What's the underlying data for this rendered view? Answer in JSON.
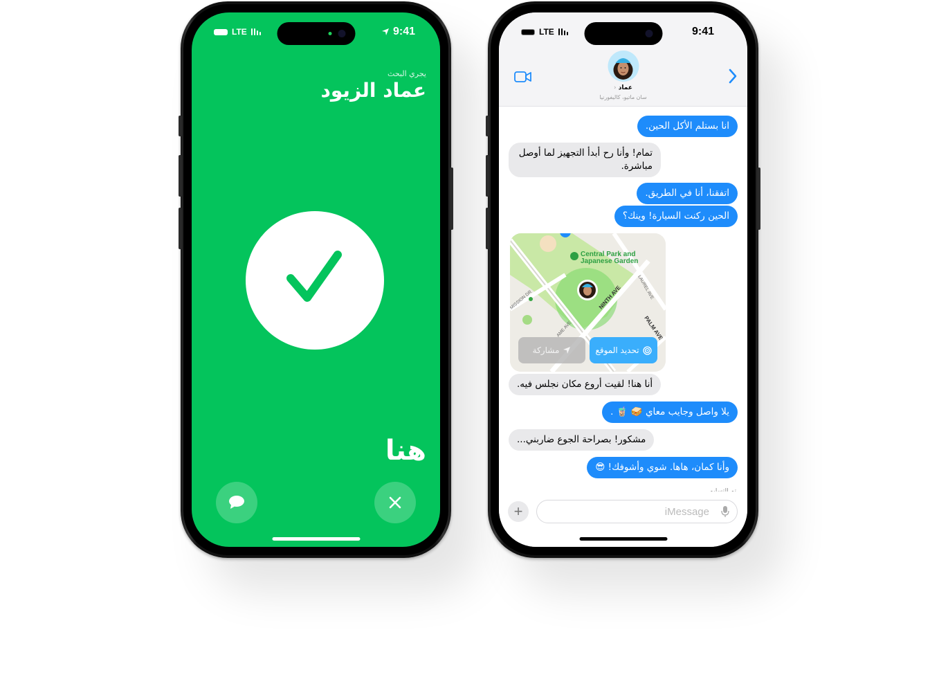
{
  "left_phone": {
    "status": {
      "network": "LTE",
      "time": "9:41"
    },
    "subtitle": "يجري البحث",
    "name": "عماد الزيود",
    "here_label": "هنا",
    "colors": {
      "background": "#04c45c"
    },
    "icons": {
      "check": "checkmark-icon",
      "message": "message-bubble-icon",
      "close": "close-x-icon"
    }
  },
  "right_phone": {
    "status": {
      "network": "LTE",
      "time": "9:41"
    },
    "header": {
      "contact_name": "عماد",
      "contact_location": "سان ماتيو، كاليفورنيا",
      "icons": {
        "video": "video-camera-icon",
        "forward": "chevron-right-icon"
      }
    },
    "messages": [
      {
        "direction": "out",
        "text": "انا بستلم الأكل الحين."
      },
      {
        "direction": "in",
        "text": "تمام! وأنا رح أبدأ التجهيز لما أوصل مباشرة."
      },
      {
        "direction": "out",
        "text": "اتفقنا، أنا في الطريق."
      },
      {
        "direction": "out",
        "text": "الحين ركنت السيارة! وينك؟"
      },
      {
        "direction": "in",
        "text": "أنا هنا! لقيت أروع مكان نجلس فيه."
      },
      {
        "direction": "out",
        "text": "يلا واصل وجايب معاي 🥪 🧋 ."
      },
      {
        "direction": "in",
        "text": "مشكور! بصراحة الجوع ضاربني..."
      },
      {
        "direction": "out",
        "text": "وأنا كمان، هاها. شوي وأشوفك! 😎"
      }
    ],
    "map": {
      "place_label_1": "Central Park and",
      "place_label_2": "Japanese Garden",
      "streets": [
        "NINTH AVE",
        "LAUREL AVE",
        "PALM AVE",
        "MISSION DR",
        "AME AVE"
      ],
      "share_button": "مشاركة",
      "refresh_button": "تحديد الموقع"
    },
    "delivered": "تم التسليم",
    "composer": {
      "placeholder": "iMessage"
    },
    "colors": {
      "outgoing": "#1e8cfb",
      "incoming": "#e9e9eb"
    }
  }
}
